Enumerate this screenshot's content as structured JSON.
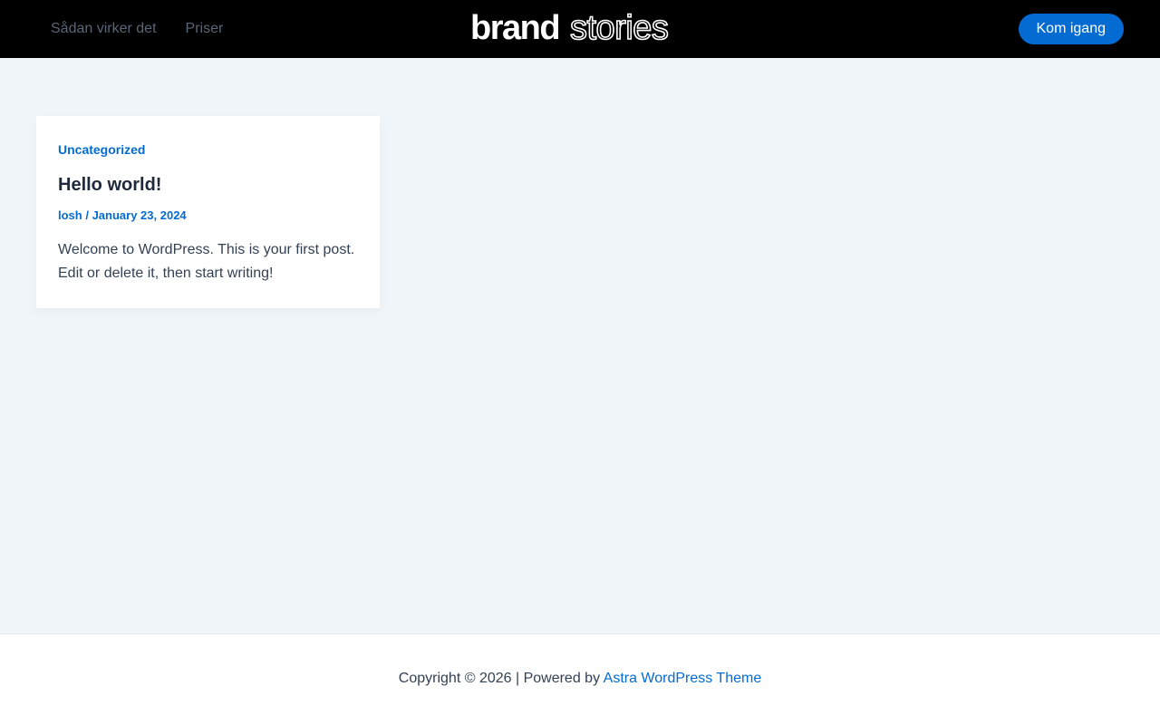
{
  "header": {
    "nav": [
      {
        "label": "Sådan virker det"
      },
      {
        "label": "Priser"
      }
    ],
    "logo": {
      "part1": "brand",
      "part2": "stories"
    },
    "cta_label": "Kom igang"
  },
  "post": {
    "category": "Uncategorized",
    "title": "Hello world!",
    "author": "losh",
    "separator": " / ",
    "date": "January 23, 2024",
    "excerpt": "Welcome to WordPress. This is your first post. Edit or delete it, then start writing!"
  },
  "footer": {
    "copyright": "Copyright © 2026 | Powered by ",
    "theme_link": "Astra WordPress Theme"
  },
  "colors": {
    "header_bg": "#000000",
    "accent": "#046bd2",
    "page_bg": "#f0f5fa"
  }
}
